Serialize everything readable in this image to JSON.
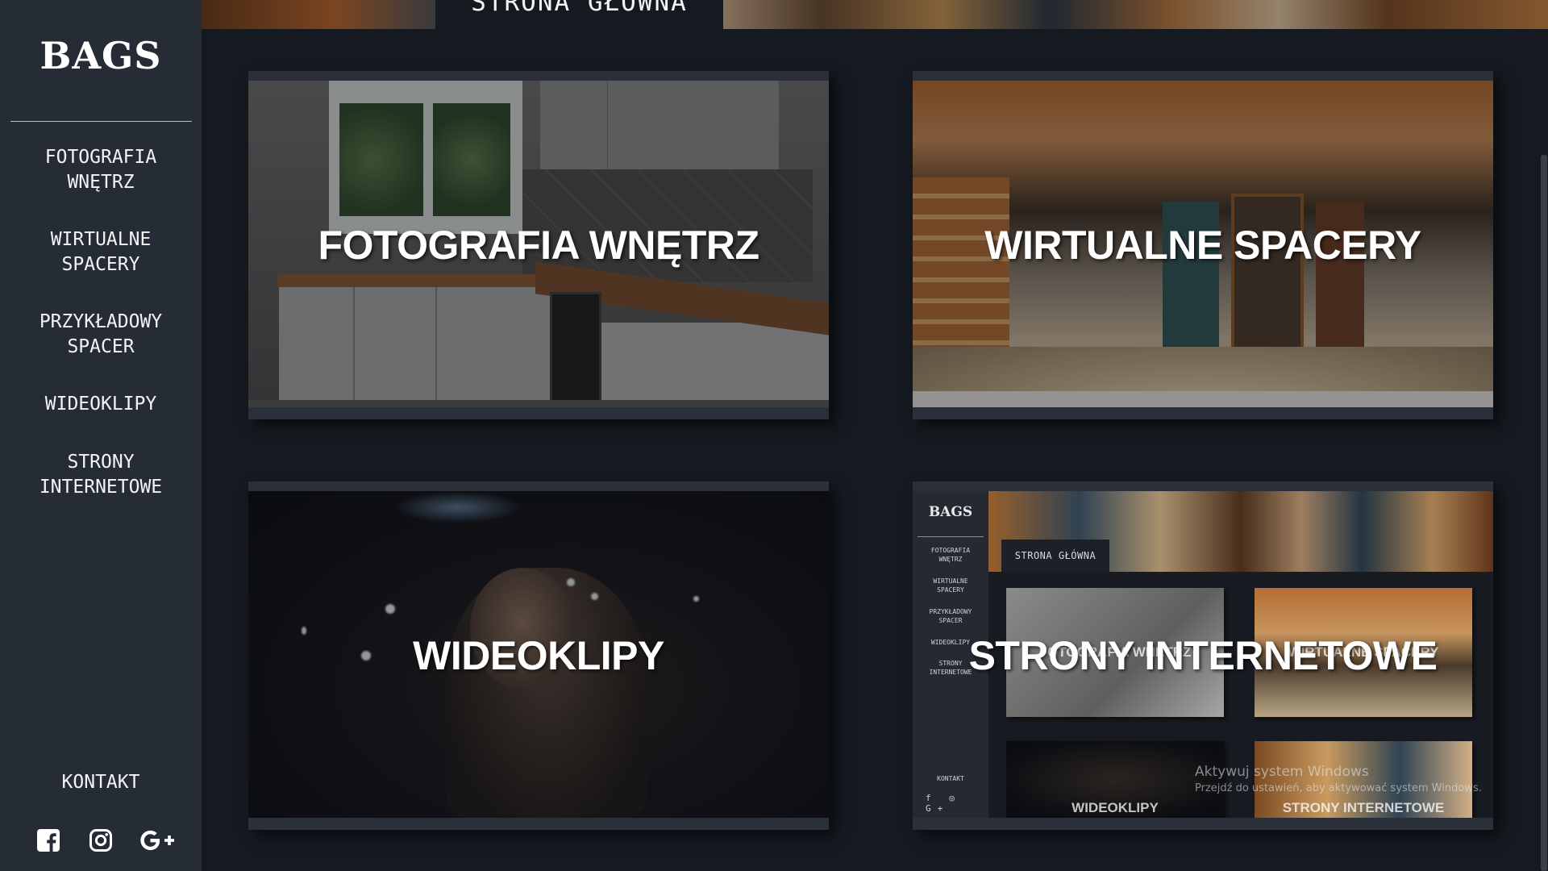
{
  "sidebar": {
    "brand": "BAGS",
    "nav": [
      {
        "label": "FOTOGRAFIA\nWNĘTRZ"
      },
      {
        "label": "WIRTUALNE\nSPACERY"
      },
      {
        "label": "PRZYKŁADOWY\nSPACER"
      },
      {
        "label": "WIDEOKLIPY"
      },
      {
        "label": "STRONY\nINTERNETOWE"
      }
    ],
    "contact": "KONTAKT",
    "social": [
      "facebook-icon",
      "instagram-icon",
      "google-plus-icon"
    ]
  },
  "header": {
    "home_tab": "STRONA GŁÓWNA"
  },
  "cards": [
    {
      "title": "FOTOGRAFIA WNĘTRZ"
    },
    {
      "title": "WIRTUALNE SPACERY"
    },
    {
      "title": "WIDEOKLIPY"
    },
    {
      "title": "STRONY INTERNETOWE"
    }
  ],
  "preview": {
    "brand": "BAGS",
    "nav": [
      "FOTOGRAFIA\nWNĘTRZ",
      "WIRTUALNE\nSPACERY",
      "PRZYKŁADOWY\nSPACER",
      "WIDEOKLIPY",
      "STRONY\nINTERNETOWE"
    ],
    "contact": "KONTAKT",
    "icons": "f ◎ G+",
    "home_tab": "STRONA GŁÓWNA",
    "thumbs": [
      "FOTOGRAFIA WNĘTRZ",
      "WIRTUALNE SPACERY",
      "WIDEOKLIPY",
      "STRONY INTERNETOWE"
    ],
    "activation_title": "Aktywuj system Windows",
    "activation_text": "Przejdź do ustawień, aby aktywować system Windows."
  },
  "colors": {
    "sidebar_bg": "#262c35",
    "page_bg": "#151a20",
    "card_bg": "#2a303a"
  }
}
